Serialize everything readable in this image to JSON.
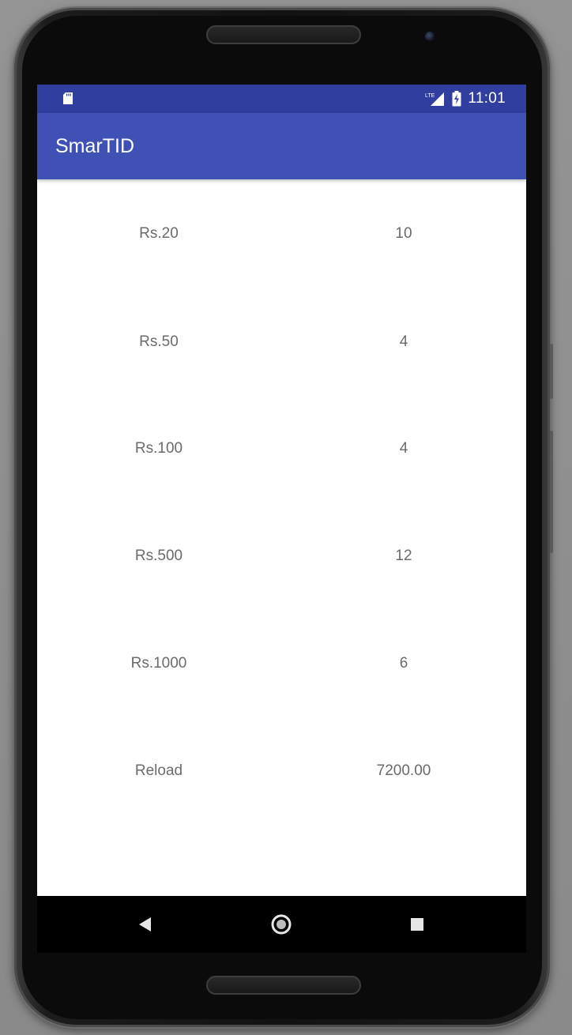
{
  "status_bar": {
    "time": "11:01",
    "network": "LTE",
    "icons": [
      "sd-card-icon",
      "lte-signal-icon",
      "battery-charging-icon"
    ]
  },
  "app_bar": {
    "title": "SmarTID"
  },
  "rows": [
    {
      "label": "Rs.20",
      "value": "10"
    },
    {
      "label": "Rs.50",
      "value": "4"
    },
    {
      "label": "Rs.100",
      "value": "4"
    },
    {
      "label": "Rs.500",
      "value": "12"
    },
    {
      "label": "Rs.1000",
      "value": "6"
    },
    {
      "label": "Reload",
      "value": "7200.00"
    }
  ],
  "nav_bar": {
    "icons": [
      "back-icon",
      "home-icon",
      "recents-icon"
    ]
  },
  "colors": {
    "status_bar": "#303f9f",
    "app_bar": "#3f51b5",
    "text_secondary": "#6b6b6b"
  }
}
